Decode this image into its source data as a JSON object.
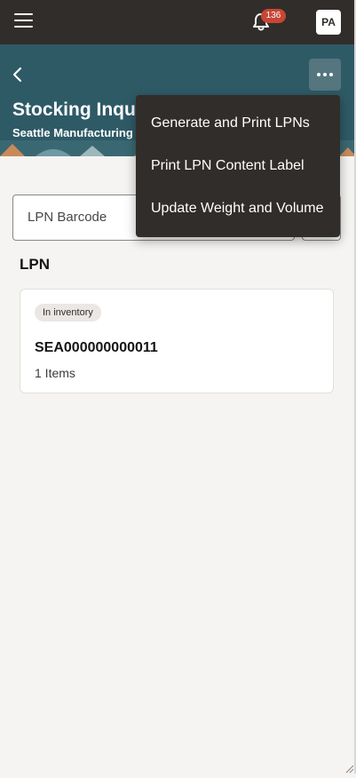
{
  "topbar": {
    "notification_count": "136",
    "avatar_initials": "PA"
  },
  "header": {
    "title": "Stocking Inquiry",
    "subtitle": "Seattle Manufacturing"
  },
  "search": {
    "placeholder": "LPN Barcode"
  },
  "results": {
    "section_title": "LPN",
    "cards": [
      {
        "status": "In inventory",
        "lpn": "SEA000000000011",
        "items": "1 Items"
      }
    ]
  },
  "overflow_menu": {
    "items": [
      {
        "label": "Generate and Print LPNs"
      },
      {
        "label": "Print LPN Content Label"
      },
      {
        "label": "Update Weight and Volume"
      }
    ]
  },
  "colors": {
    "topbar": "#312d2a",
    "header": "#2e5a66",
    "badge": "#c74634",
    "menu": "#312d2a"
  }
}
